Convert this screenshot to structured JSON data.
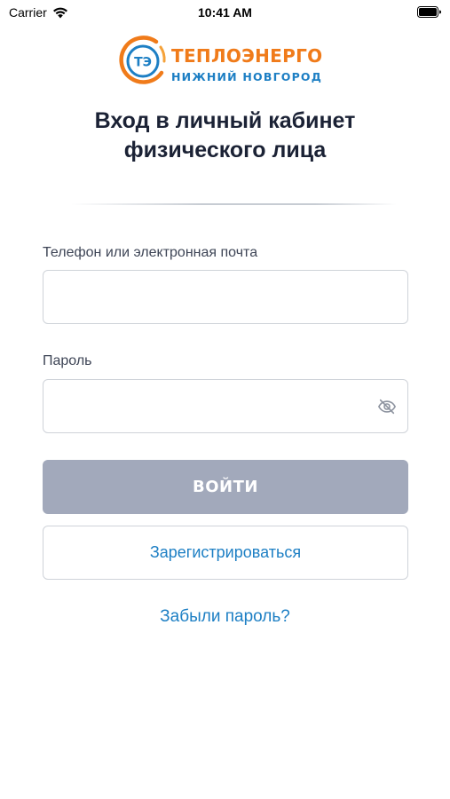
{
  "status_bar": {
    "carrier": "Carrier",
    "time": "10:41 AM"
  },
  "logo": {
    "mark_text": "ТЭ",
    "company_name": "ТЕПЛОЭНЕРГО",
    "city": "НИЖНИЙ НОВГОРОД",
    "colors": {
      "orange": "#f07b1a",
      "blue": "#1d7fc4"
    }
  },
  "title": {
    "line1": "Вход в личный кабинет",
    "line2": "физического лица"
  },
  "form": {
    "login_label": "Телефон или электронная почта",
    "login_value": "",
    "password_label": "Пароль",
    "password_value": "",
    "password_toggle_icon": "eye-off-icon"
  },
  "actions": {
    "login_button": "ВОЙТИ",
    "register_button": "Зарегистрироваться",
    "forgot_link": "Забыли пароль?"
  },
  "colors": {
    "primary_disabled": "#a2a9bb",
    "link": "#1d7fc4",
    "text": "#1b2235"
  }
}
